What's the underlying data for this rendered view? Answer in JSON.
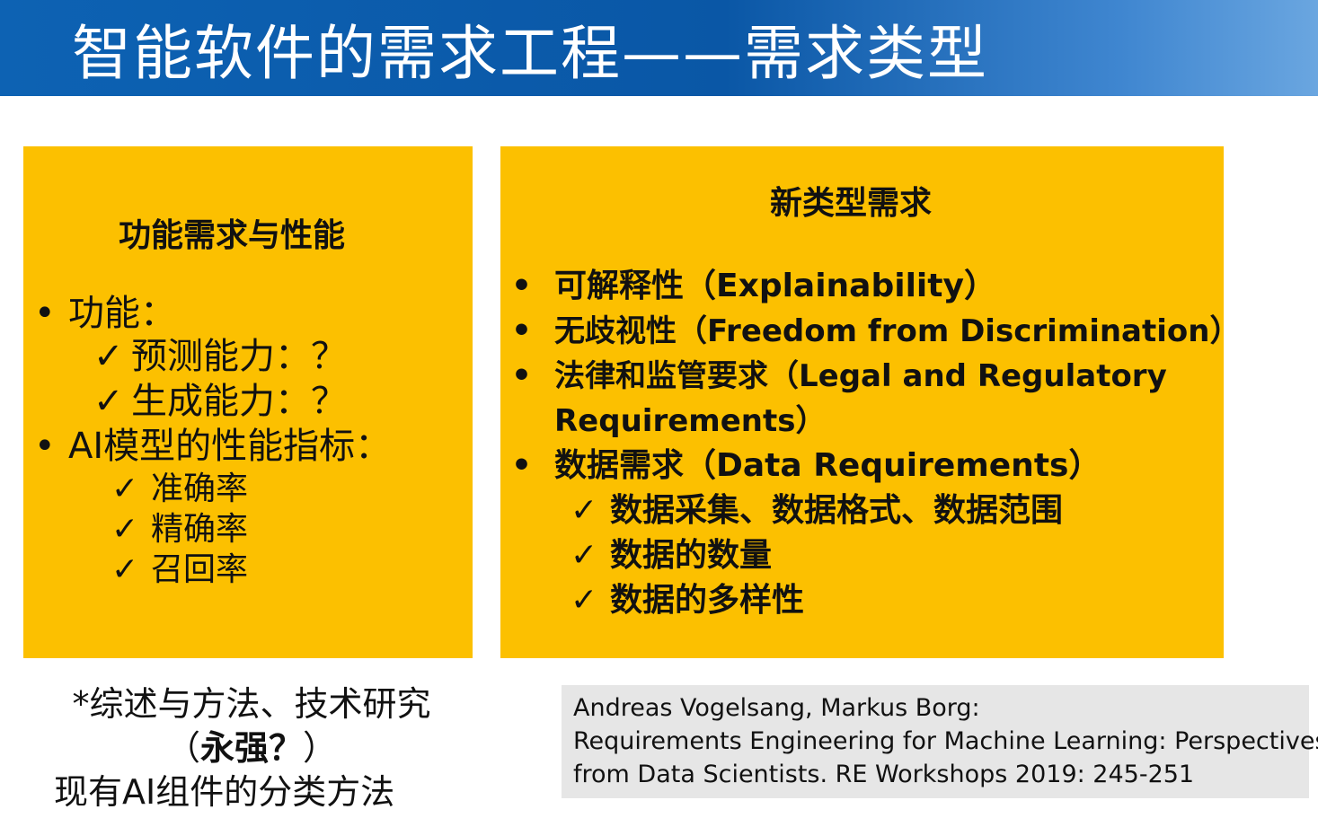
{
  "header": {
    "title": "智能软件的需求工程——需求类型"
  },
  "left_box": {
    "title": "功能需求与性能",
    "items": [
      {
        "bullet": "•",
        "text": "功能："
      },
      {
        "check": "✓",
        "text": "预测能力：？"
      },
      {
        "check": "✓",
        "text": "生成能力：？"
      },
      {
        "bullet": "•",
        "text": "AI模型的性能指标："
      },
      {
        "check": "✓",
        "text": "准确率"
      },
      {
        "check": "✓",
        "text": "精确率"
      },
      {
        "check": "✓",
        "text": "召回率"
      }
    ]
  },
  "right_box": {
    "title": "新类型需求",
    "items": [
      {
        "bullet": "•",
        "text": "可解释性（Explainability）"
      },
      {
        "bullet": "•",
        "text": "无歧视性（Freedom from Discrimination）"
      },
      {
        "bullet": "•",
        "text": "法律和监管要求（Legal and Regulatory"
      },
      {
        "text": "Requirements）"
      },
      {
        "bullet": "•",
        "text": "数据需求（Data Requirements）"
      },
      {
        "check": "✓",
        "text": "数据采集、数据格式、数据范围"
      },
      {
        "check": "✓",
        "text": "数据的数量"
      },
      {
        "check": "✓",
        "text": "数据的多样性"
      }
    ]
  },
  "note": {
    "line1": "*综述与方法、技术研究",
    "line2_open": "（",
    "line2_bold": "永强？",
    "line2_close": "）",
    "line3": "现有AI组件的分类方法"
  },
  "reference": {
    "line1": "Andreas Vogelsang, Markus Borg:",
    "line2": "Requirements Engineering for Machine Learning: Perspectives",
    "line3": "from Data Scientists. RE Workshops 2019: 245-251"
  },
  "colors": {
    "header_blue": "#0a57a6",
    "box_yellow": "#fcc000",
    "ref_gray": "#e6e6e6"
  }
}
